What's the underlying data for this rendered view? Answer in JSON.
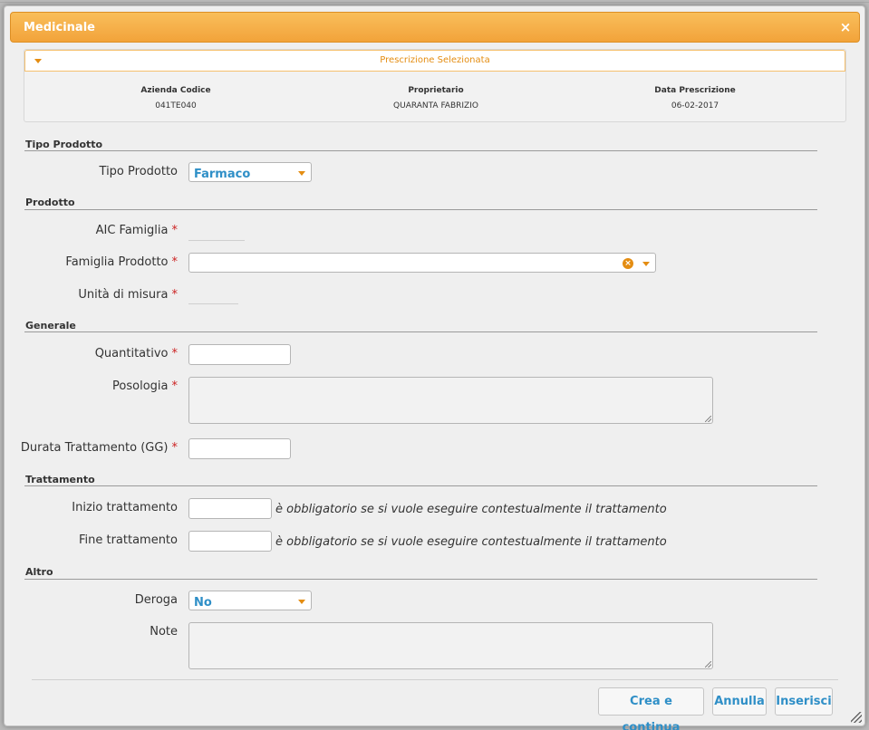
{
  "dialog": {
    "title": "Medicinale",
    "close_glyph": "×"
  },
  "prescription": {
    "title": "Prescrizione Selezionata",
    "columns": [
      {
        "header": "Azienda Codice",
        "value": "041TE040"
      },
      {
        "header": "Proprietario",
        "value": "QUARANTA FABRIZIO"
      },
      {
        "header": "Data Prescrizione",
        "value": "06-02-2017"
      }
    ]
  },
  "sections": {
    "tipo_prodotto": "Tipo Prodotto",
    "prodotto": "Prodotto",
    "generale": "Generale",
    "trattamento": "Trattamento",
    "altro": "Altro"
  },
  "fields": {
    "tipo_prodotto": {
      "label": "Tipo Prodotto",
      "value": "Farmaco"
    },
    "aic_famiglia": {
      "label": "AIC Famiglia",
      "required_mark": "*",
      "value": ""
    },
    "famiglia_prodotto": {
      "label": "Famiglia Prodotto",
      "required_mark": "*",
      "value": "",
      "clear_glyph": "×"
    },
    "unita_misura": {
      "label": "Unità di misura",
      "required_mark": "*",
      "value": ""
    },
    "quantitativo": {
      "label": "Quantitativo",
      "required_mark": "*",
      "value": ""
    },
    "posologia": {
      "label": "Posologia",
      "required_mark": "*",
      "value": ""
    },
    "durata": {
      "label": "Durata Trattamento (GG)",
      "required_mark": "*",
      "value": ""
    },
    "inizio": {
      "label": "Inizio trattamento",
      "value": "",
      "hint": "è obbligatorio se si vuole eseguire contestualmente il trattamento"
    },
    "fine": {
      "label": "Fine trattamento",
      "value": "",
      "hint": "è obbligatorio se si vuole eseguire contestualmente il trattamento"
    },
    "deroga": {
      "label": "Deroga",
      "value": "No"
    },
    "note": {
      "label": "Note",
      "value": ""
    }
  },
  "buttons": {
    "crea": "Crea e continua",
    "annulla": "Annulla",
    "inserisci": "Inserisci"
  },
  "colors": {
    "accent": "#f2a33a",
    "link_blue": "#2f8fc7",
    "required": "#cc2222"
  }
}
